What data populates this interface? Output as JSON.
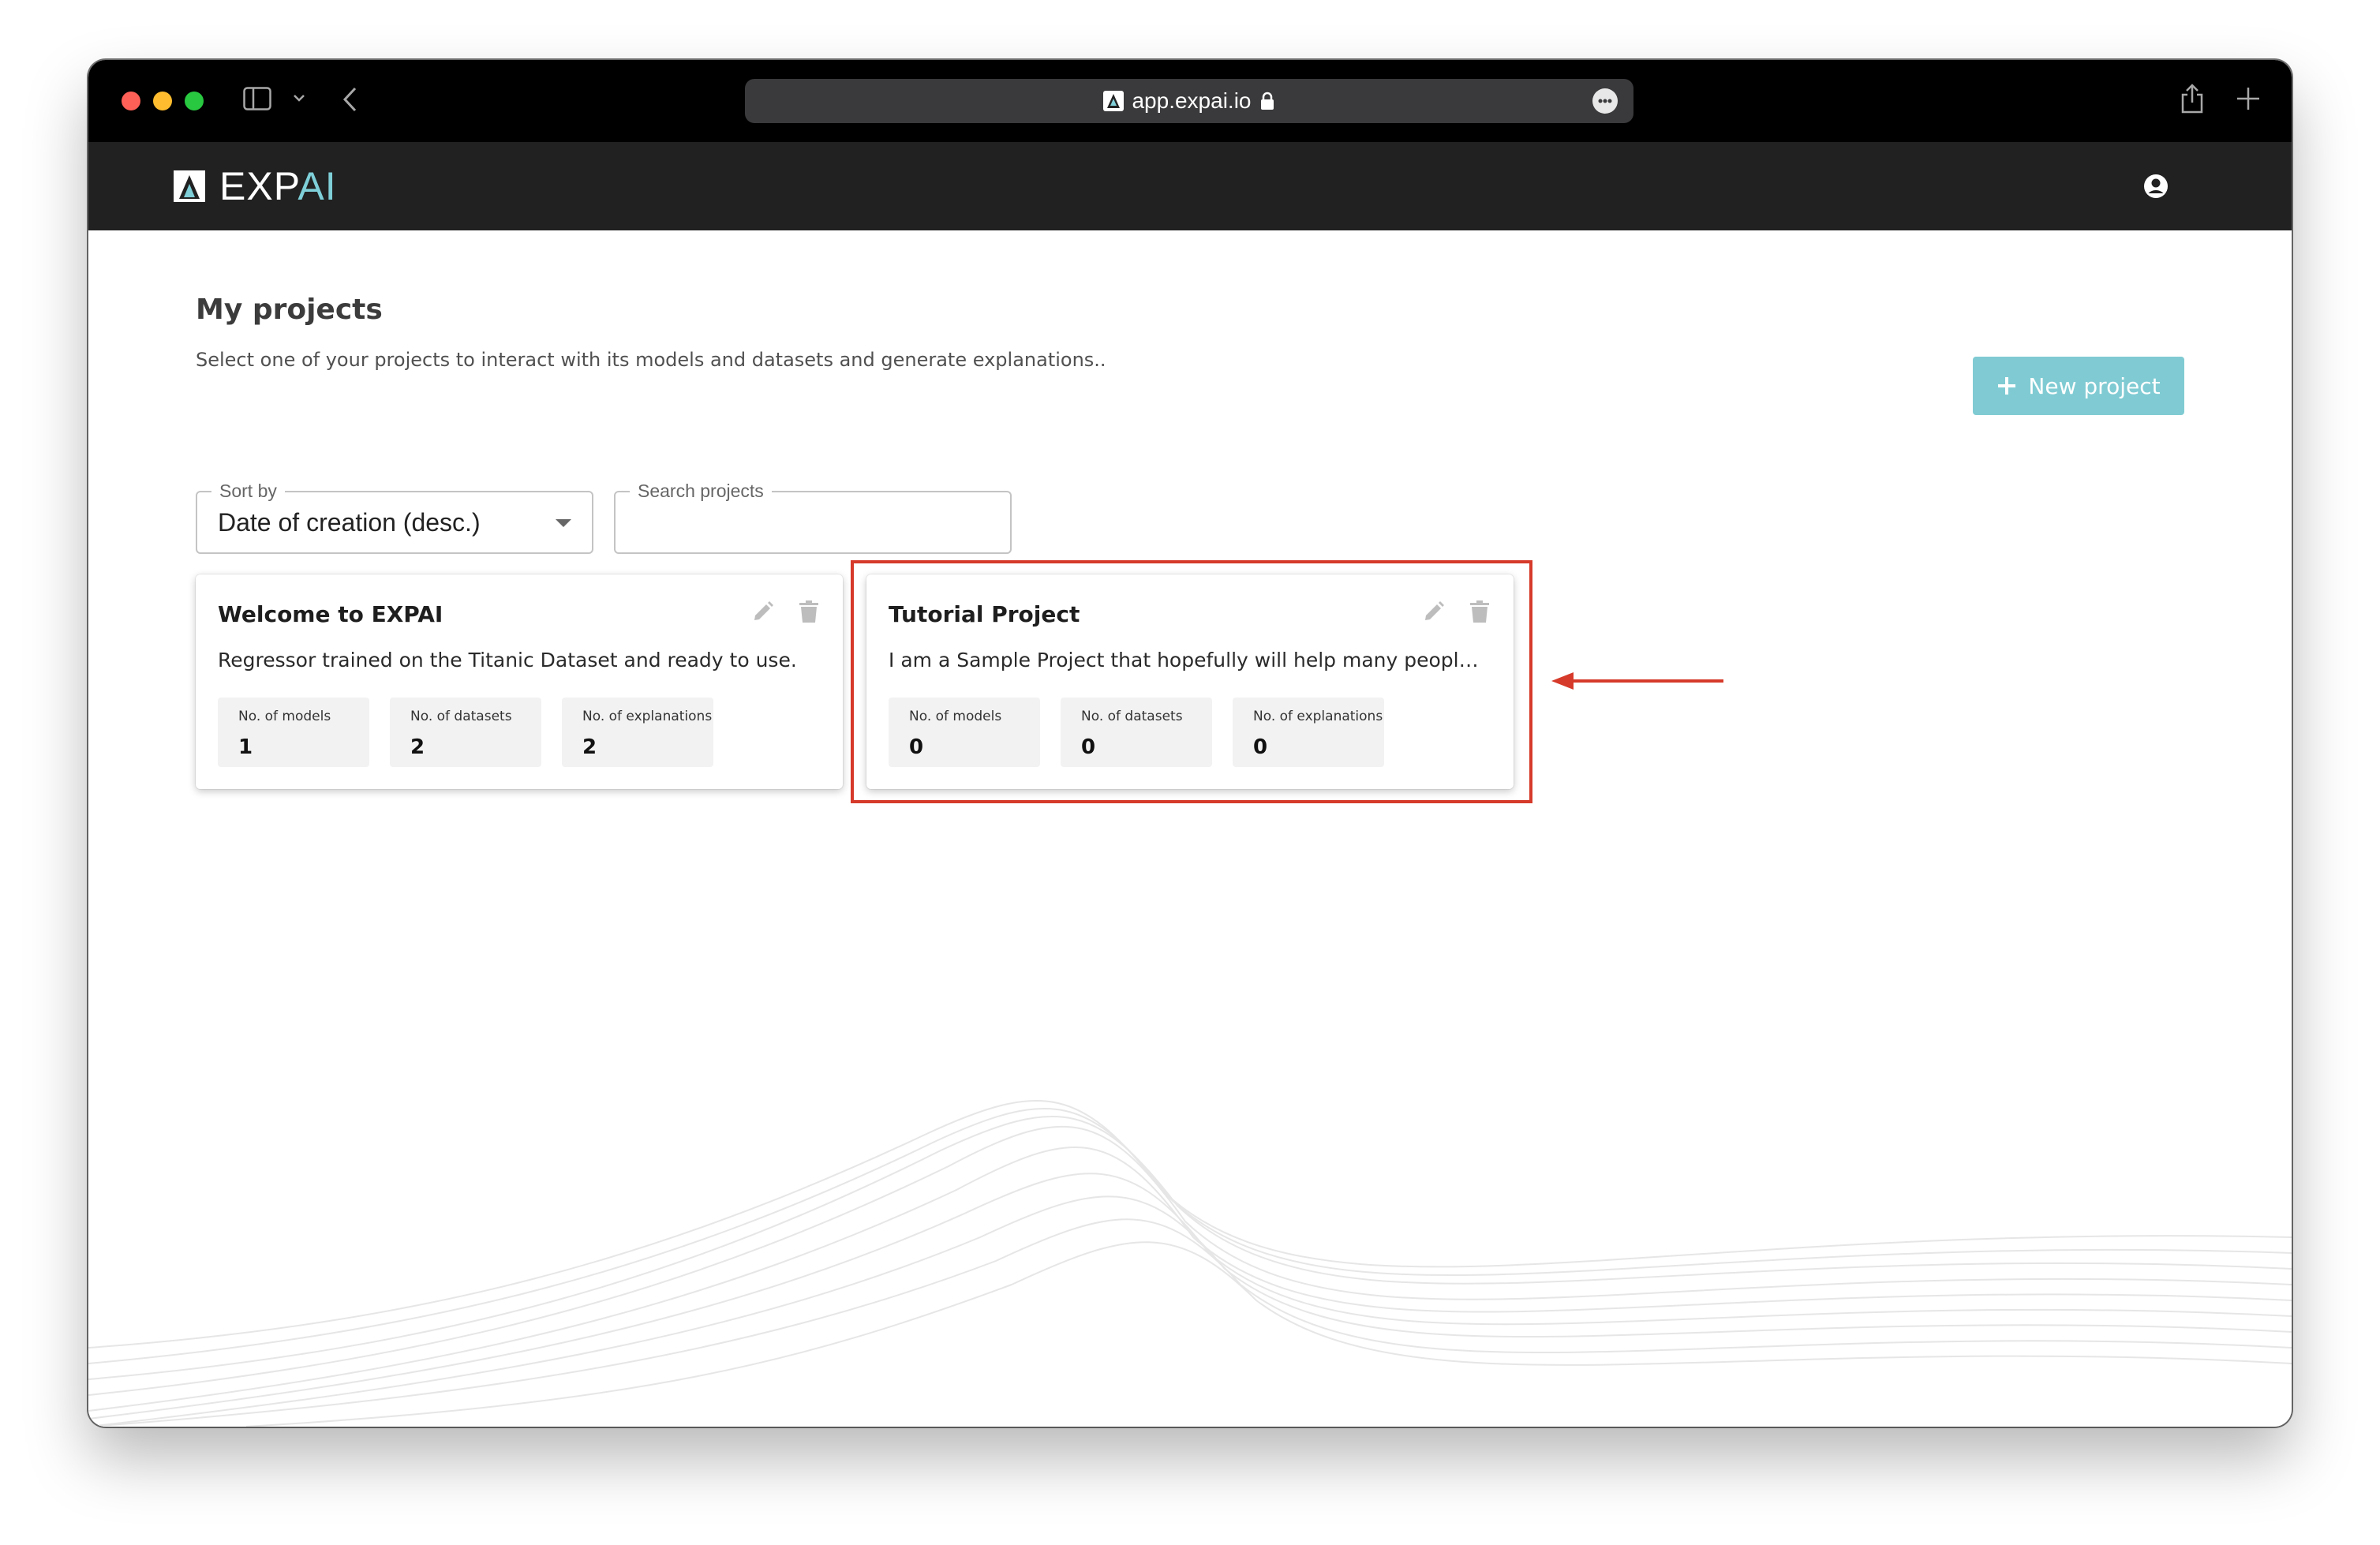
{
  "browser": {
    "url": "app.expai.io"
  },
  "app": {
    "logo": {
      "prefix": "EXP",
      "accent": "AI"
    }
  },
  "page": {
    "title": "My projects",
    "subtitle": "Select one of your projects to interact with its models and datasets and generate explanations..",
    "new_project_label": "New project",
    "sort": {
      "label": "Sort by",
      "value": "Date of creation (desc.)"
    },
    "search": {
      "label": "Search projects",
      "value": ""
    }
  },
  "projects": [
    {
      "title": "Welcome to EXPAI",
      "description": "Regressor trained on the Titanic Dataset and ready to use.",
      "stats": [
        {
          "label": "No. of models",
          "value": "1"
        },
        {
          "label": "No. of datasets",
          "value": "2"
        },
        {
          "label": "No. of explanations",
          "value": "2"
        }
      ]
    },
    {
      "title": "Tutorial Project",
      "description": "I am a Sample Project that hopefully will help many people w...",
      "stats": [
        {
          "label": "No. of models",
          "value": "0"
        },
        {
          "label": "No. of datasets",
          "value": "0"
        },
        {
          "label": "No. of explanations",
          "value": "0"
        }
      ]
    }
  ],
  "icons": {
    "account": "account-circle-icon",
    "edit": "pencil-icon",
    "delete": "trash-icon",
    "add": "plus-icon"
  },
  "colors": {
    "accent": "#80cbd3",
    "appbar": "#212121",
    "annotation": "#d63a2a"
  }
}
